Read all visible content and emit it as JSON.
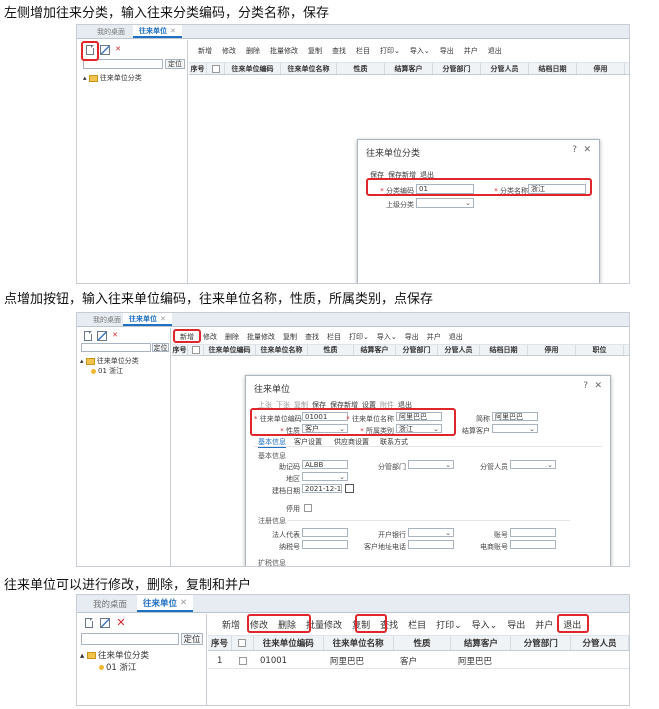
{
  "captions": {
    "step1": "左侧增加往来分类，输入往来分类编码，分类名称，保存",
    "step2": "点增加按钮，输入往来单位编码，往来单位名称，性质，所属类别，点保存",
    "step3": "往来单位可以进行修改，删除，复制和并户"
  },
  "tabs": {
    "desktop": "我的桌面",
    "current": "往来单位",
    "close": "✕"
  },
  "left": {
    "locate": "定位",
    "tree_root": "往来单位分类",
    "tree_child": "01 浙江"
  },
  "toolbar": {
    "add": "新增",
    "edit": "修改",
    "delete": "删除",
    "batch_edit": "批量修改",
    "copy": "复制",
    "find": "查找",
    "columns": "栏目",
    "print": "打印",
    "import": "导入",
    "export": "导出",
    "merge": "并户",
    "exit": "退出",
    "caret": "⌄"
  },
  "grid": {
    "cols1": [
      "序号",
      "",
      "往来单位编码",
      "往来单位名称",
      "性质",
      "结算客户",
      "分管部门",
      "分管人员",
      "结档日期",
      "停用"
    ],
    "cols2": [
      "序号",
      "",
      "往来单位编码",
      "往来单位名称",
      "性质",
      "结算客户",
      "分管部门",
      "分管人员",
      "结档日期",
      "停用",
      "职位"
    ],
    "cols3": [
      "序号",
      "",
      "往来单位编码",
      "往来单位名称",
      "性质",
      "结算客户",
      "分管部门",
      "分管人员"
    ],
    "row": {
      "no": "1",
      "code": "01001",
      "name": "阿里巴巴",
      "nature": "客户",
      "settle": "阿里巴巴"
    }
  },
  "dialog1": {
    "title": "往来单位分类",
    "help": "?",
    "close": "✕",
    "actions": [
      "保存",
      "保存新增",
      "退出"
    ],
    "code_label": "分类编码",
    "code_value": "01",
    "name_label": "分类名称",
    "name_value": "浙江",
    "parent_label": "上级分类",
    "parent_value": ""
  },
  "dialog2": {
    "title": "往来单位",
    "help": "?",
    "close": "✕",
    "actions": [
      "上张",
      "下张",
      "复制",
      "保存",
      "保存新增",
      "设置",
      "附件",
      "退出"
    ],
    "code_label": "往来单位编码",
    "code_value": "01001",
    "name_label": "往来单位名称",
    "name_value": "阿里巴巴",
    "short_label": "简称",
    "short_value": "阿里巴巴",
    "nature_label": "性质",
    "nature_value": "客户",
    "category_label": "所属类别",
    "category_value": "浙江",
    "settle_label": "结算客户",
    "subtabs": [
      "基本信息",
      "客户设置",
      "供应商设置",
      "联系方式"
    ],
    "basic_section": "基本信息",
    "mnemonic_label": "助记码",
    "mnemonic_value": "ALBB",
    "dept_label": "分管部门",
    "person_label": "分管人员",
    "region_label": "地区",
    "date_label": "建档日期",
    "date_value": "2021-12-16",
    "disabled_label": "停用",
    "reg_section": "注册信息",
    "legal_label": "法人代表",
    "bank_label": "开户银行",
    "account_label": "账号",
    "tax_label": "纳税号",
    "addr_label": "客户地址电话",
    "phone_label": "电商账号",
    "invoice_section": "扩税信息"
  }
}
